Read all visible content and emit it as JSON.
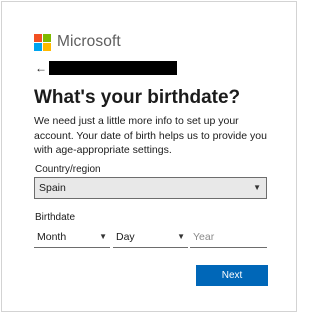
{
  "brand": {
    "name": "Microsoft",
    "logo_colors": [
      "#f25022",
      "#7fba00",
      "#00a4ef",
      "#ffb900"
    ]
  },
  "header": {
    "back_icon": "back-arrow-icon",
    "account_identifier_redacted": true
  },
  "page": {
    "title": "What's your birthdate?",
    "description": "We need just a little more info to set up your account. Your date of birth helps us to provide you with age-appropriate settings."
  },
  "form": {
    "country_label": "Country/region",
    "country_value": "Spain",
    "birthdate_label": "Birthdate",
    "month_value": "Month",
    "day_value": "Day",
    "year_placeholder": "Year",
    "dropdown_icon": "chevron-down-icon"
  },
  "actions": {
    "next_label": "Next",
    "accent_color": "#0067b8"
  }
}
